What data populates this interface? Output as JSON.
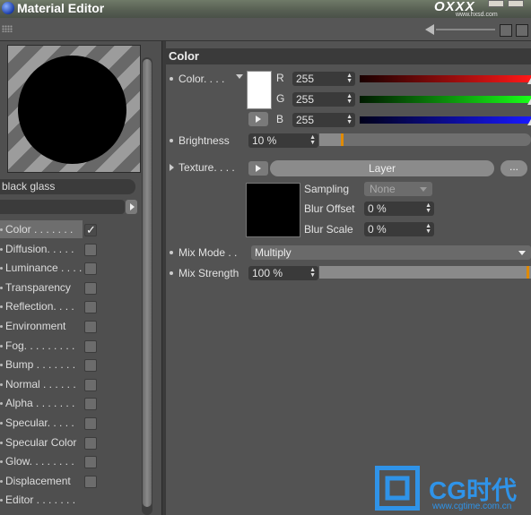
{
  "window": {
    "title": "Material Editor",
    "brand": "OXXX",
    "brand_url": "www.hxsd.com"
  },
  "material": {
    "name": "black glass"
  },
  "channels": [
    {
      "label": "Color . . . . . . .",
      "checked": true,
      "selected": true
    },
    {
      "label": "Diffusion. . . . .",
      "checked": false
    },
    {
      "label": "Luminance . . . .",
      "checked": false
    },
    {
      "label": "Transparency",
      "checked": false
    },
    {
      "label": "Reflection. . . .",
      "checked": false
    },
    {
      "label": "Environment",
      "checked": false
    },
    {
      "label": "Fog. . . . . . . . .",
      "checked": false
    },
    {
      "label": "Bump . . . . . . .",
      "checked": false
    },
    {
      "label": "Normal . . . . . .",
      "checked": false
    },
    {
      "label": "Alpha . . . . . . .",
      "checked": false
    },
    {
      "label": "Specular. . . . .",
      "checked": false
    },
    {
      "label": "Specular Color",
      "checked": false
    },
    {
      "label": "Glow. . . . . . . .",
      "checked": false
    },
    {
      "label": "Displacement",
      "checked": false
    },
    {
      "label": "Editor . . . . . . .",
      "checked": null
    }
  ],
  "color_panel": {
    "header": "Color",
    "color_label": "Color. . . .",
    "swatch_color": "#ffffff",
    "r_label": "R",
    "r_value": "255",
    "r_level": 1.0,
    "g_label": "G",
    "g_value": "255",
    "g_level": 1.0,
    "b_label": "B",
    "b_value": "255",
    "b_level": 1.0,
    "brightness_label": "Brightness",
    "brightness_value": "10 %",
    "brightness_level": 0.1,
    "texture_label": "Texture. . . .",
    "layer_label": "Layer",
    "dots_label": "...",
    "sampling_label": "Sampling",
    "sampling_value": "None",
    "blur_offset_label": "Blur Offset",
    "blur_offset_value": "0 %",
    "blur_scale_label": "Blur Scale",
    "blur_scale_value": "0 %",
    "mix_mode_label": "Mix Mode . .",
    "mix_mode_value": "Multiply",
    "mix_strength_label": "Mix Strength",
    "mix_strength_value": "100 %",
    "mix_strength_level": 1.0
  },
  "watermark": {
    "text": "CG时代",
    "url": "www.cgtime.com.cn"
  }
}
